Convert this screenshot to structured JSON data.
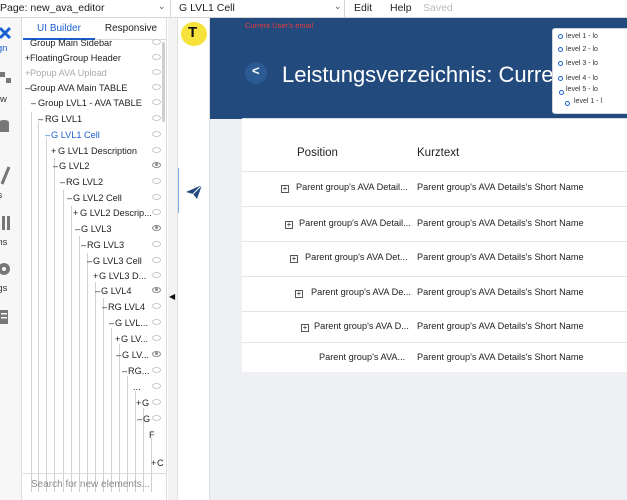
{
  "topbar": {
    "page_label": "Page: new_ava_editor",
    "element_select": "G LVL1 Cell",
    "menu_edit": "Edit",
    "menu_help": "Help",
    "saved": "Saved"
  },
  "rail": [
    "sign",
    "flow",
    "ta",
    "les",
    "gins",
    "ings",
    "gs"
  ],
  "tree": {
    "tabs": [
      "UI Builder",
      "Responsive"
    ],
    "rows": [
      "Group Main Sidebar",
      "FloatingGroup Header",
      "Popup AVA Upload",
      "Group AVA Main TABLE",
      "Group LVL1 - AVA TABLE",
      "RG LVL1",
      "G LVL1 Cell",
      "G LVL1 Description",
      "G LVL2",
      "RG LVL2",
      "G LVL2 Cell",
      "G LVL2 Descrip...",
      "G LVL3",
      "RG LVL3",
      "G LVL3 Cell",
      "G LVL3 D...",
      "G LVL4",
      "RG LVL4",
      "G LVL...",
      "G LV...",
      "G LV...",
      "RG...",
      "...",
      "G",
      "G",
      "F",
      "",
      "C"
    ],
    "search_placeholder": "Search for new elements..."
  },
  "canvas": {
    "badge": "T",
    "email_label": "Current User's email",
    "back": "<",
    "title": "Leistungsverzeichnis: Current",
    "dropdown": [
      "level 1 - lo",
      "level 2 - lo",
      "level 3 - lo",
      "level 4 - lo",
      "level 5 - lo",
      "level 1 - l"
    ],
    "col_position": "Position",
    "col_kurztext": "Kurztext",
    "rows": [
      {
        "position": "Parent group's AVA Detail...",
        "kurztext": "Parent group's AVA Details's Short Name"
      },
      {
        "position": "Parent group's AVA Detail...",
        "kurztext": "Parent group's AVA Details's Short Name"
      },
      {
        "position": "Parent group's AVA Det...",
        "kurztext": "Parent group's AVA Details's Short Name"
      },
      {
        "position": "Parent group's AVA De...",
        "kurztext": "Parent group's AVA Details's Short Name"
      },
      {
        "position": "Parent group's AVA D...",
        "kurztext": "Parent group's AVA Details's Short Name"
      },
      {
        "position": "Parent group's AVA...",
        "kurztext": "Parent group's AVA Details's Short Name"
      }
    ]
  },
  "colors": {
    "header": "#234a7c",
    "accent": "#1c5fcf",
    "badge": "#f7e23b",
    "email": "#e23b3b"
  }
}
